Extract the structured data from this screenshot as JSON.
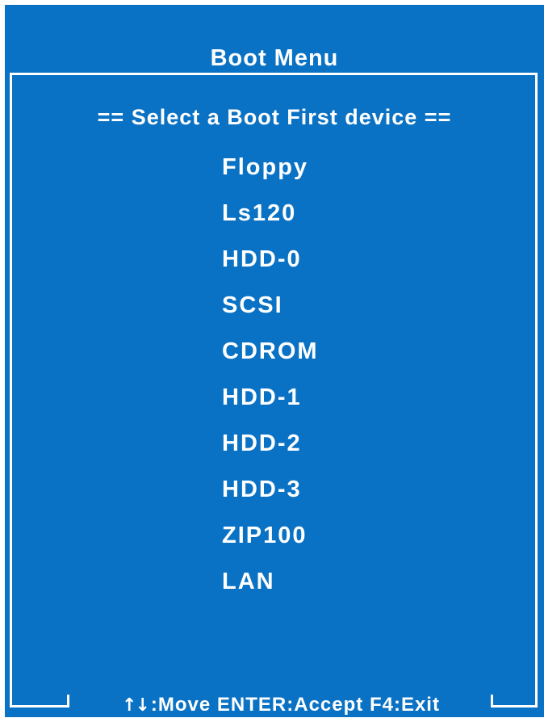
{
  "header": {
    "title": "Boot Menu"
  },
  "menu": {
    "prompt": "== Select a Boot First device ==",
    "items": [
      {
        "label": "Floppy"
      },
      {
        "label": "Ls120"
      },
      {
        "label": "HDD-0"
      },
      {
        "label": "SCSI"
      },
      {
        "label": "CDROM"
      },
      {
        "label": "HDD-1"
      },
      {
        "label": "HDD-2"
      },
      {
        "label": "HDD-3"
      },
      {
        "label": "ZIP100"
      },
      {
        "label": "LAN"
      }
    ]
  },
  "footer": {
    "arrows_glyph": "↑↓",
    "hint": ":Move ENTER:Accept F4:Exit"
  },
  "colors": {
    "background": "#0a72c4",
    "text": "#ffffff"
  },
  "icons": {
    "navigation": "up-down-arrows-icon"
  }
}
